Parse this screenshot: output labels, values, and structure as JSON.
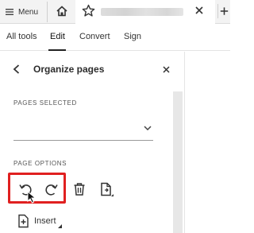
{
  "titlebar": {
    "menu_label": "Menu",
    "icons": [
      "hamburger-icon",
      "home-icon",
      "star-icon",
      "close-icon",
      "plus-icon"
    ]
  },
  "menubar": {
    "items": [
      "All tools",
      "Edit",
      "Convert",
      "Sign"
    ],
    "active": "Edit"
  },
  "panel": {
    "title": "Organize pages",
    "pages_selected_label": "PAGES SELECTED",
    "pages_selected_value": "",
    "page_options_label": "PAGE OPTIONS",
    "insert_label": "Insert",
    "tools": [
      "rotate-counterclockwise-icon",
      "rotate-clockwise-icon",
      "delete-icon",
      "page-options-icon"
    ]
  },
  "colors": {
    "highlight": "#e02020",
    "titlebar_bg": "#f3f3f3",
    "scrollbar": "#e7e7e7"
  }
}
